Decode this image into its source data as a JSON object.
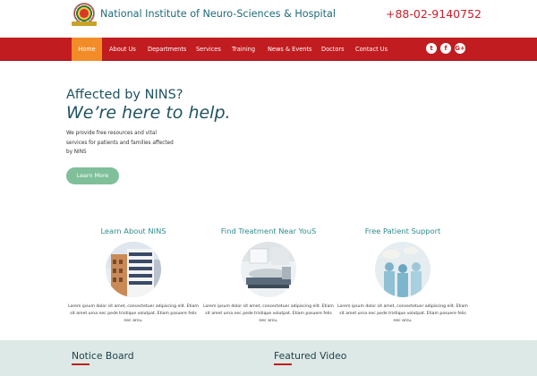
{
  "header": {
    "site_title": "National Institute of Neuro-Sciences & Hospital",
    "phone": "+88-02-9140752"
  },
  "nav": {
    "items": [
      {
        "label": "Home"
      },
      {
        "label": "About Us"
      },
      {
        "label": "Departments"
      },
      {
        "label": "Services"
      },
      {
        "label": "Training"
      },
      {
        "label": "News & Events"
      },
      {
        "label": "Doctors"
      },
      {
        "label": "Contact Us"
      }
    ],
    "social": [
      {
        "label": "t",
        "icon": "twitter-icon"
      },
      {
        "label": "f",
        "icon": "facebook-icon"
      },
      {
        "label": "G+",
        "icon": "google-plus-icon"
      }
    ]
  },
  "hero": {
    "line1": "Affected by NINS?",
    "line2": "We’re here to help.",
    "description": "We provide free resources and vital services for patients and families affected by NINS",
    "button": "Learn More"
  },
  "features": [
    {
      "title": "Learn About NINS",
      "text": "Lorem ipsum dolor sit amet, consectetuer adipiscing elit. Etiam sit amet urna nec pede tristique volutpat. Etiam posuere felis nec arcu."
    },
    {
      "title": "Find Treatment Near YouS",
      "text": "Lorem ipsum dolor sit amet, consectetuer adipiscing elit. Etiam sit amet urna nec pede tristique volutpat. Etiam posuere felis nec arcu."
    },
    {
      "title": "Free Patient Support",
      "text": "Lorem ipsum dolor sit amet, consectetuer adipiscing elit. Etiam sit amet urna nec pede tristique volutpat. Etiam posuere felis nec arcu."
    }
  ],
  "bottom": {
    "notice_title": "Notice Board",
    "video_title": "Featured Video"
  },
  "colors": {
    "nav_red": "#c11c20",
    "nav_active": "#f28c28",
    "title_teal": "#1f6a7a",
    "button_green": "#7fbf9a",
    "band_bg": "#dde9e6"
  }
}
